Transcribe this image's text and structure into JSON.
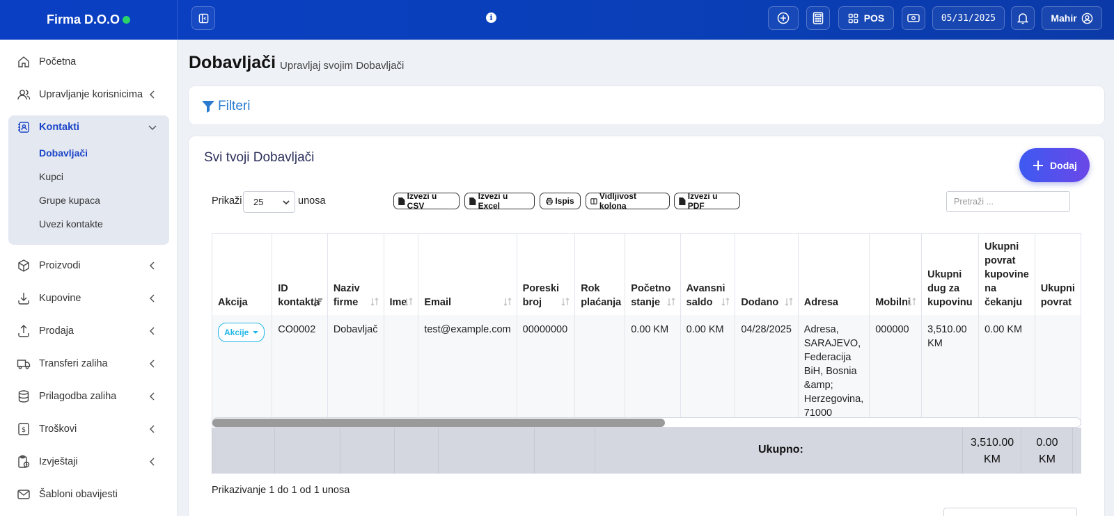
{
  "header": {
    "company": "Firma D.O.O",
    "pos_label": "POS",
    "date": "05/31/2025",
    "user": "Mahir"
  },
  "sidebar": {
    "items": [
      {
        "label": "Početna",
        "icon": "home-icon"
      },
      {
        "label": "Upravljanje korisnicima",
        "icon": "users-icon"
      },
      {
        "label": "Kontakti",
        "icon": "contacts-icon"
      },
      {
        "label": "Proizvodi",
        "icon": "box-icon"
      },
      {
        "label": "Kupovine",
        "icon": "download-icon"
      },
      {
        "label": "Prodaja",
        "icon": "upload-icon"
      },
      {
        "label": "Transferi zaliha",
        "icon": "truck-icon"
      },
      {
        "label": "Prilagodba zaliha",
        "icon": "database-icon"
      },
      {
        "label": "Troškovi",
        "icon": "money-icon"
      },
      {
        "label": "Izvještaji",
        "icon": "report-icon"
      },
      {
        "label": "Šabloni obavijesti",
        "icon": "mail-icon"
      }
    ],
    "contacts_sub": [
      "Dobavljači",
      "Kupci",
      "Grupe kupaca",
      "Uvezi kontakte"
    ]
  },
  "page": {
    "title": "Dobavljači",
    "subtitle": "Upravljaj svojim Dobavljači",
    "filters": "Filteri",
    "card_title": "Svi tvoji Dobavljači",
    "add": "Dodaj",
    "show": "Prikaži",
    "show_value": "25",
    "entries": "unosa",
    "search_placeholder": "Pretraži ...",
    "info": "Prikazivanje 1 do 1 od 1 unosa"
  },
  "export_buttons": [
    "Izvezi u CSV",
    "Izvezi u Excel",
    "Ispis",
    "Vidljivost kolona",
    "Izvezi u PDF"
  ],
  "table": {
    "headers": [
      "Akcija",
      "ID kontakta",
      "Naziv firme",
      "Ime",
      "Email",
      "Poreski broj",
      "Rok plaćanja",
      "Početno stanje",
      "Avansni saldo",
      "Dodano",
      "Adresa",
      "Mobilni",
      "Ukupni dug za kupovinu",
      "Ukupni povrat kupovine na čekanju",
      "Ukupni povrat"
    ],
    "row": {
      "action": "Akcije",
      "id": "CO0002",
      "company": "Dobavljač",
      "name": "",
      "email": "test@example.com",
      "tax": "00000000",
      "pay_term": "",
      "opening": "0.00 KM",
      "advance": "0.00 KM",
      "added": "04/28/2025",
      "address": "Adresa, SARAJEVO, Federacija BiH, Bosnia &amp; Herzegovina, 71000",
      "mobile": "000000",
      "due": "3,510.00 KM",
      "return_due": "0.00 KM"
    },
    "footer": {
      "total_label": "Ukupno:",
      "due_total_1": "3,510.00",
      "due_total_2": "KM",
      "return_total_1": "0.00",
      "return_total_2": "KM"
    }
  },
  "colors": {
    "header": "#0a3fc4",
    "accent": "#1a44c7",
    "add_button": "#4a55ee",
    "badge_dot": "#2bd46b"
  }
}
